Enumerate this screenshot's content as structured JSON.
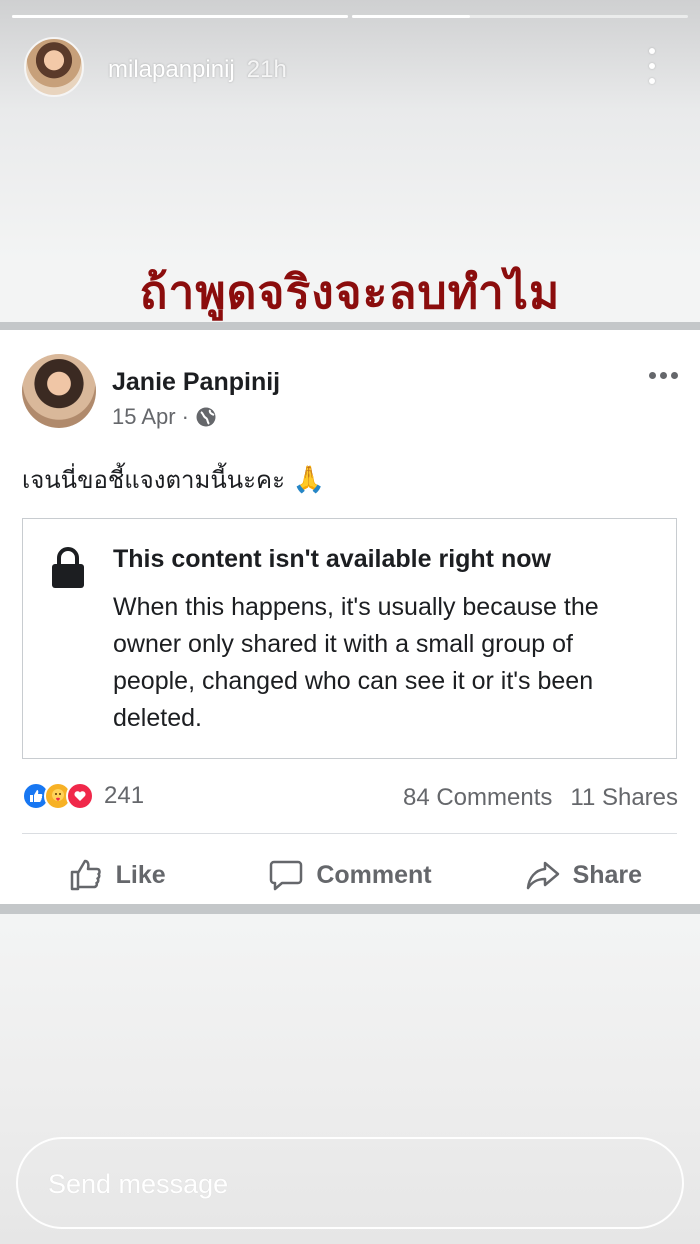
{
  "story": {
    "progress": [
      1.0,
      0.35
    ],
    "username": "milapanpinij",
    "time": "21h",
    "caption": "ถ้าพูดจริงจะลบทำไม",
    "reply_placeholder": "Send message"
  },
  "post": {
    "author": "Janie Panpinij",
    "date": "15 Apr",
    "separator": "·",
    "text": "เจนนี่ขอชี้แจงตามนี้นะคะ",
    "emoji": "🙏",
    "unavailable": {
      "title": "This content isn't available right now",
      "body": "When this happens, it's usually because the owner only shared it with a small group of people, changed who can see it or it's been deleted."
    },
    "reactions": {
      "icons": [
        "like-reaction-icon",
        "care-reaction-icon",
        "love-reaction-icon"
      ],
      "count": "241"
    },
    "comments": "84 Comments",
    "shares": "11 Shares",
    "actions": {
      "like": "Like",
      "comment": "Comment",
      "share": "Share"
    }
  },
  "colors": {
    "caption": "#8b0d0d",
    "fb_blue": "#1877f2",
    "love_red": "#f0284a",
    "care_yellow": "#f7b125",
    "secondary_text": "#65676b"
  }
}
